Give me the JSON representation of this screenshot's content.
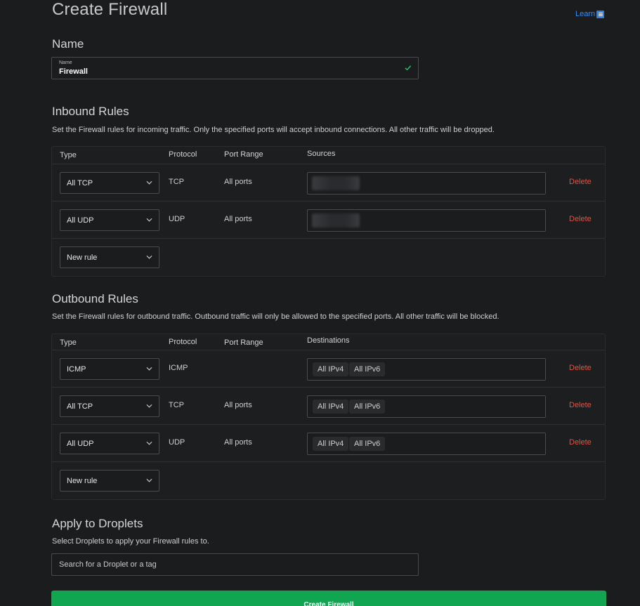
{
  "page": {
    "title": "Create Firewall",
    "learn_label": "Learn"
  },
  "name_section": {
    "title": "Name",
    "field_label": "Name",
    "field_value": "Firewall"
  },
  "inbound": {
    "title": "Inbound Rules",
    "description": "Set the Firewall rules for incoming traffic. Only the specified ports will accept inbound connections. All other traffic will be dropped.",
    "headers": {
      "type": "Type",
      "protocol": "Protocol",
      "port_range": "Port Range",
      "sources": "Sources"
    },
    "rows": [
      {
        "type": "All TCP",
        "protocol": "TCP",
        "port_range": "All ports",
        "delete": "Delete"
      },
      {
        "type": "All UDP",
        "protocol": "UDP",
        "port_range": "All ports",
        "delete": "Delete"
      }
    ],
    "new_rule_label": "New rule"
  },
  "outbound": {
    "title": "Outbound Rules",
    "description": "Set the Firewall rules for outbound traffic. Outbound traffic will only be allowed to the specified ports. All other traffic will be blocked.",
    "headers": {
      "type": "Type",
      "protocol": "Protocol",
      "port_range": "Port Range",
      "destinations": "Destinations"
    },
    "rows": [
      {
        "type": "ICMP",
        "protocol": "ICMP",
        "port_range": "",
        "tag1": "All IPv4",
        "tag2": "All IPv6",
        "delete": "Delete"
      },
      {
        "type": "All TCP",
        "protocol": "TCP",
        "port_range": "All ports",
        "tag1": "All IPv4",
        "tag2": "All IPv6",
        "delete": "Delete"
      },
      {
        "type": "All UDP",
        "protocol": "UDP",
        "port_range": "All ports",
        "tag1": "All IPv4",
        "tag2": "All IPv6",
        "delete": "Delete"
      }
    ],
    "new_rule_label": "New rule"
  },
  "droplets": {
    "title": "Apply to Droplets",
    "description": "Select Droplets to apply your Firewall rules to.",
    "search_placeholder": "Search for a Droplet or a tag"
  },
  "actions": {
    "create_label": "Create Firewall"
  },
  "colors": {
    "background": "#1b1c1e",
    "primary_green": "#11a552",
    "delete_red": "#e8513f",
    "link_blue": "#3a8cf2",
    "valid_check": "#22c55e"
  }
}
